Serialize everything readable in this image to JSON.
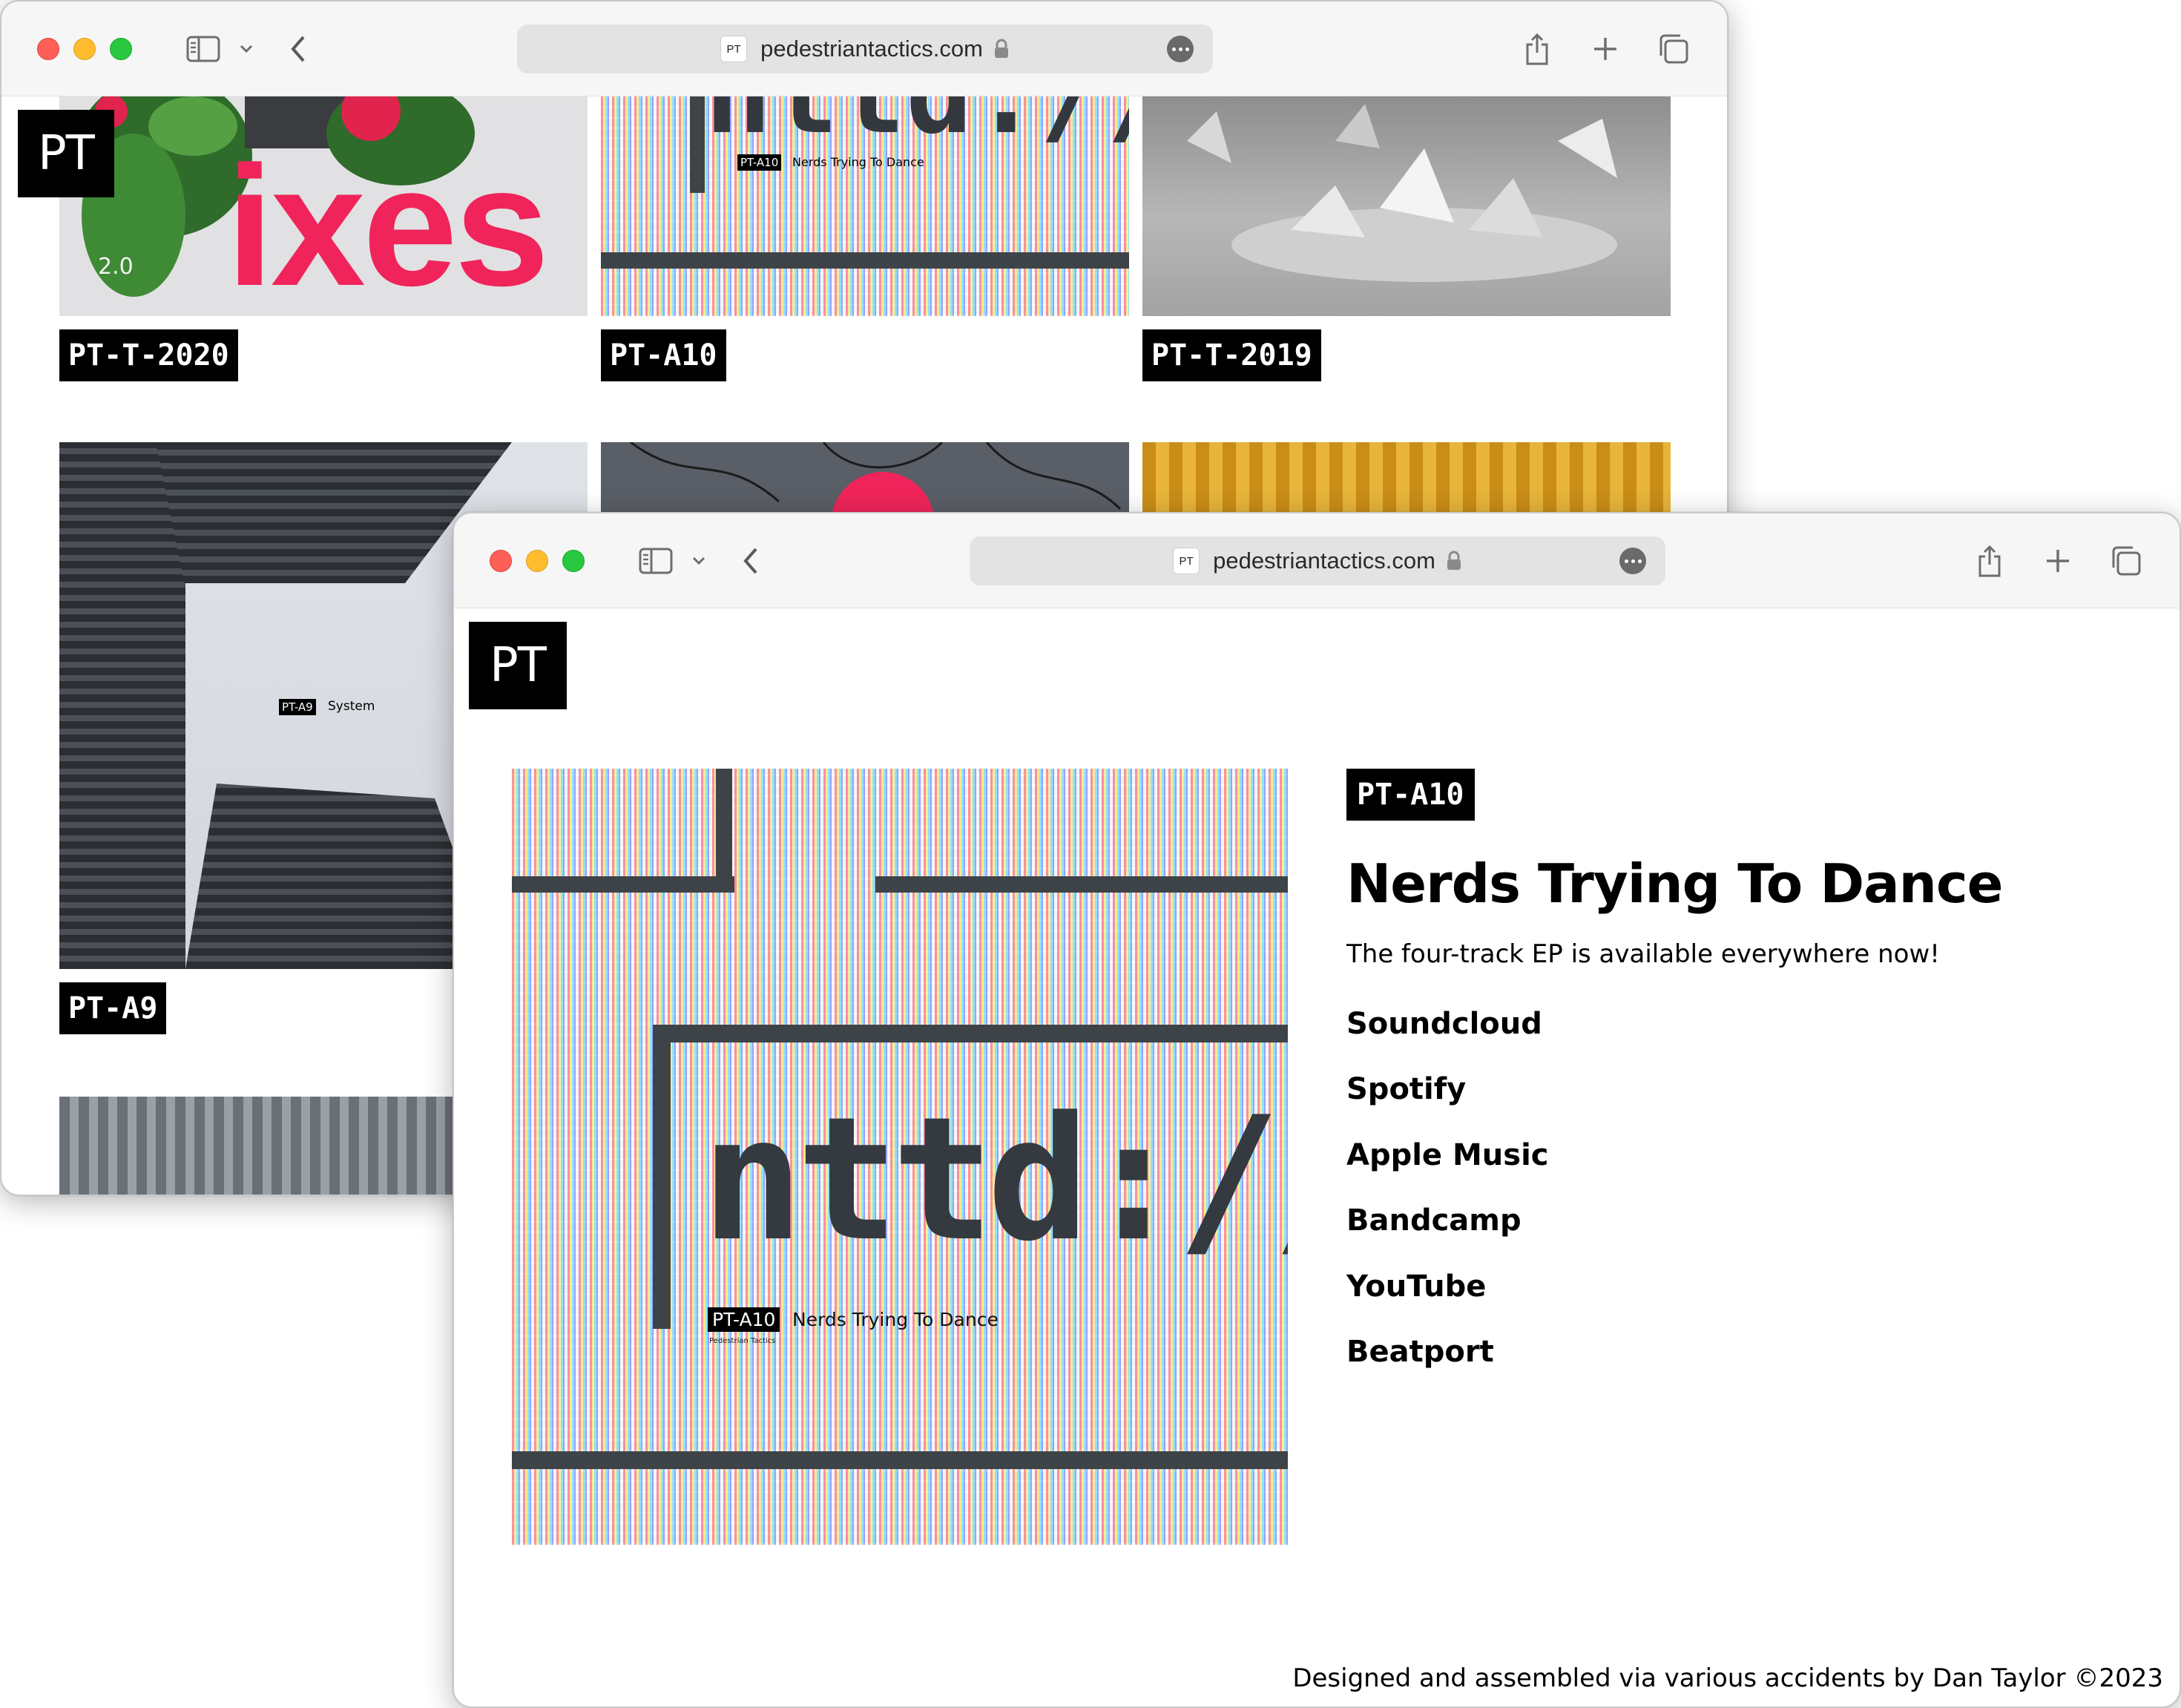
{
  "back_window": {
    "url": "pedestriantactics.com",
    "favicon_text": "PT",
    "logo": "PT",
    "releases": [
      {
        "code": "PT-T-2020",
        "art_text": "ixes",
        "art_corner": "2.0"
      },
      {
        "code": "PT-A10",
        "art_caption_code": "PT-A10",
        "art_caption_title": "Nerds Trying To Dance",
        "art_big": "nttd://"
      },
      {
        "code": "PT-T-2019"
      },
      {
        "code": "PT-A9",
        "art_caption_code": "PT-A9",
        "art_caption_title": "System"
      }
    ]
  },
  "front_window": {
    "url": "pedestriantactics.com",
    "favicon_text": "PT",
    "logo": "PT",
    "release": {
      "code": "PT-A10",
      "title": "Nerds Trying To Dance",
      "description": "The four-track EP is available everywhere now!",
      "art_big_text": "nttd://",
      "art_caption_code": "PT-A10",
      "art_caption_title": "Nerds Trying To Dance",
      "art_caption_artist": "Pedestrian Tactics",
      "links": [
        {
          "label": "Soundcloud"
        },
        {
          "label": "Spotify"
        },
        {
          "label": "Apple Music"
        },
        {
          "label": "Bandcamp"
        },
        {
          "label": "YouTube"
        },
        {
          "label": "Beatport"
        }
      ]
    },
    "footer": "Designed and assembled via various accidents by Dan Taylor ©2023"
  },
  "icons": [
    "sidebar-icon",
    "chevron-down-icon",
    "back-arrow-icon",
    "lock-icon",
    "more-icon",
    "share-icon",
    "plus-icon",
    "tabs-overview-icon"
  ],
  "colors": {
    "accent_pink": "#f0245a",
    "gold": "#d9a52a",
    "black": "#000000"
  }
}
